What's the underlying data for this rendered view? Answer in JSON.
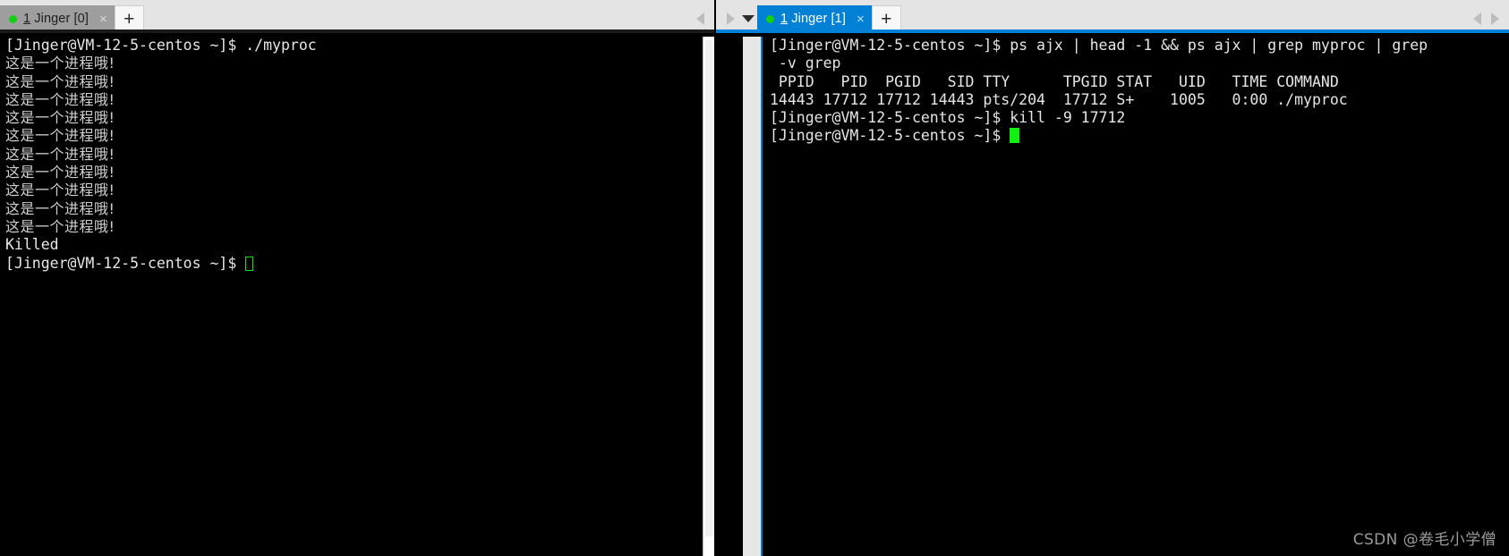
{
  "left_pane": {
    "tab": {
      "label_index": "1",
      "label_text": " Jinger [0]",
      "close_glyph": "×",
      "status_dot_color": "#15cf15"
    },
    "new_tab_glyph": "+",
    "nav": {
      "prev_glyph": "◀"
    },
    "terminal": {
      "lines": [
        {
          "type": "prompt",
          "text": "[Jinger@VM-12-5-centos ~]$ ./myproc"
        },
        {
          "type": "cn",
          "text": "这是一个进程哦!"
        },
        {
          "type": "cn",
          "text": "这是一个进程哦!"
        },
        {
          "type": "cn",
          "text": "这是一个进程哦!"
        },
        {
          "type": "cn",
          "text": "这是一个进程哦!"
        },
        {
          "type": "cn",
          "text": "这是一个进程哦!"
        },
        {
          "type": "cn",
          "text": "这是一个进程哦!"
        },
        {
          "type": "cn",
          "text": "这是一个进程哦!"
        },
        {
          "type": "cn",
          "text": "这是一个进程哦!"
        },
        {
          "type": "cn",
          "text": "这是一个进程哦!"
        },
        {
          "type": "cn",
          "text": "这是一个进程哦!"
        },
        {
          "type": "killed",
          "text": "Killed"
        }
      ],
      "final_prompt": "[Jinger@VM-12-5-centos ~]$ ",
      "cursor": "hollow"
    }
  },
  "right_pane": {
    "tab": {
      "label_index": "1",
      "label_text": " Jinger [1]",
      "close_glyph": "×",
      "status_dot_color": "#15cf15"
    },
    "new_tab_glyph": "+",
    "nav": {
      "play_glyph": "▶",
      "dropdown_glyph": "▼",
      "prev_glyph": "◀",
      "next_glyph": "▶"
    },
    "terminal": {
      "lines": [
        {
          "type": "prompt",
          "text": "[Jinger@VM-12-5-centos ~]$ ps ajx | head -1 && ps ajx | grep myproc | grep"
        },
        {
          "type": "prompt",
          "text": " -v grep"
        },
        {
          "type": "prompt",
          "text": " PPID   PID  PGID   SID TTY      TPGID STAT   UID   TIME COMMAND"
        },
        {
          "type": "prompt",
          "text": "14443 17712 17712 14443 pts/204  17712 S+    1005   0:00 ./myproc"
        },
        {
          "type": "prompt",
          "text": "[Jinger@VM-12-5-centos ~]$ kill -9 17712"
        }
      ],
      "final_prompt": "[Jinger@VM-12-5-centos ~]$ ",
      "cursor": "solid"
    }
  },
  "watermark": "CSDN @卷毛小学僧",
  "colors": {
    "active_tab_bg": "#0081d6",
    "inactive_tab_bg": "#9e9e9e",
    "tabbar_bg": "#e4e4e4",
    "terminal_bg": "#000000",
    "terminal_fg": "#d8d8d8",
    "cursor_green": "#12f012"
  }
}
